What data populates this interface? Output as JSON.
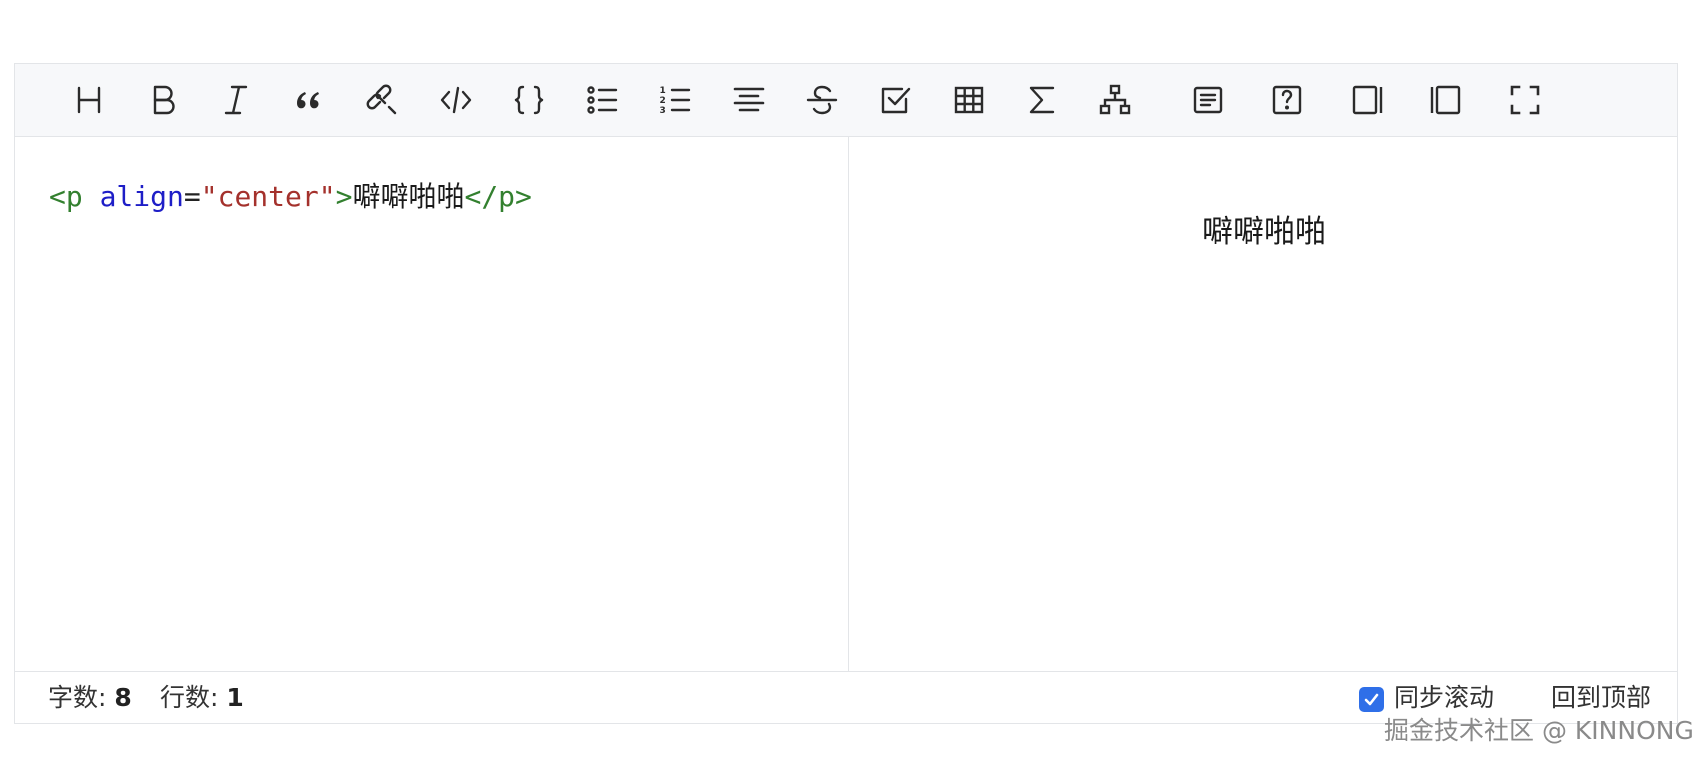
{
  "toolbar": {
    "buttons": [
      {
        "name": "heading-button",
        "icon": "heading-icon"
      },
      {
        "name": "bold-button",
        "icon": "bold-icon"
      },
      {
        "name": "italic-button",
        "icon": "italic-icon"
      },
      {
        "name": "quote-button",
        "icon": "quote-icon"
      },
      {
        "name": "link-button",
        "icon": "link-icon"
      },
      {
        "name": "inline-code-button",
        "icon": "code-icon"
      },
      {
        "name": "code-block-button",
        "icon": "braces-icon"
      },
      {
        "name": "unordered-list-button",
        "icon": "bullet-list-icon"
      },
      {
        "name": "ordered-list-button",
        "icon": "numbered-list-icon"
      },
      {
        "name": "align-center-button",
        "icon": "align-center-icon"
      },
      {
        "name": "strikethrough-button",
        "icon": "strikethrough-icon"
      },
      {
        "name": "task-list-button",
        "icon": "checkbox-icon"
      },
      {
        "name": "table-button",
        "icon": "table-icon"
      },
      {
        "name": "formula-button",
        "icon": "sigma-icon"
      },
      {
        "name": "diagram-button",
        "icon": "sitemap-icon"
      },
      {
        "name": "toc-button",
        "icon": "document-icon"
      },
      {
        "name": "help-button",
        "icon": "help-icon"
      },
      {
        "name": "preview-only-button",
        "icon": "sidebar-right-icon"
      },
      {
        "name": "edit-only-button",
        "icon": "sidebar-left-icon"
      },
      {
        "name": "fullscreen-button",
        "icon": "fullscreen-icon"
      }
    ]
  },
  "source": {
    "tag_open": "<p",
    "attr_name": "align",
    "equals": "=",
    "attr_value": "\"center\"",
    "tag_open_close": ">",
    "text": "噼噼啪啪",
    "tag_close": "</p>"
  },
  "preview": {
    "text": "噼噼啪啪",
    "align": "center"
  },
  "status": {
    "char_count_label": "字数:",
    "char_count": "8",
    "line_count_label": "行数:",
    "line_count": "1",
    "sync_scroll_label": "同步滚动",
    "sync_scroll_checked": true,
    "back_to_top_label": "回到顶部"
  },
  "watermark": "掘金技术社区 @ KINNONG",
  "colors": {
    "accent": "#2f6fe8",
    "tag": "#33802f",
    "attr": "#1e1ec7",
    "string": "#a4312c",
    "toolbar_bg": "#f7f8fa",
    "border": "#e3e5e8"
  }
}
